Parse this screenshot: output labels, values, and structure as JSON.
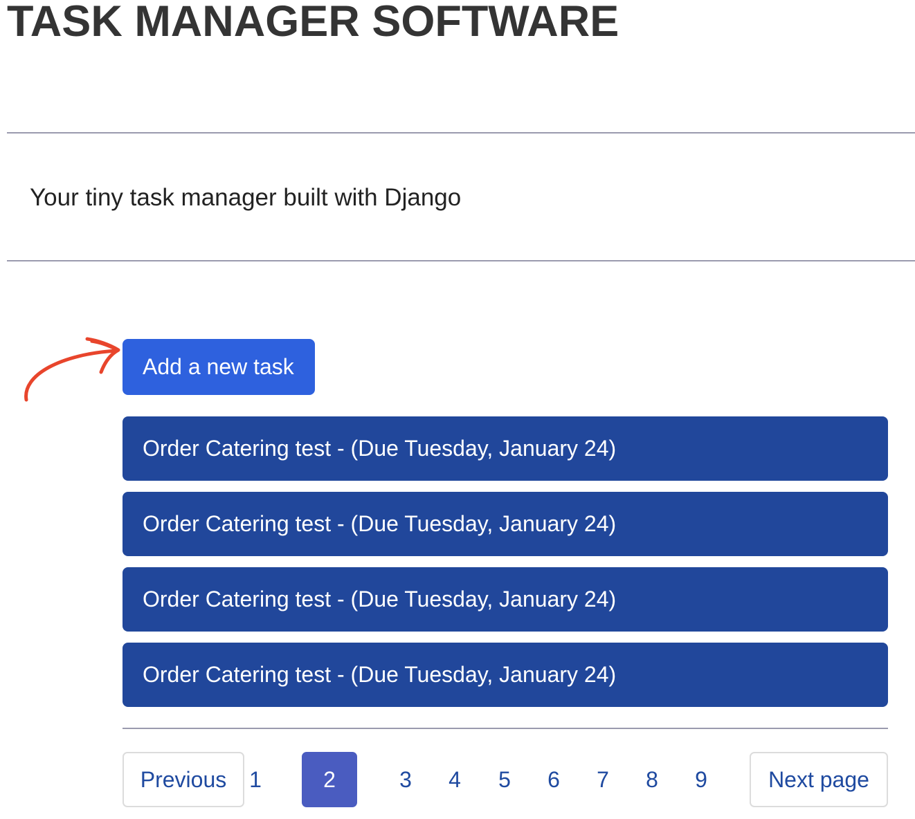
{
  "header": {
    "title": "TASK MANAGER SOFTWARE",
    "tagline": "Your tiny task manager built with Django"
  },
  "actions": {
    "add_task_label": "Add a new task"
  },
  "tasks": [
    {
      "label": "Order Catering test - (Due Tuesday, January 24)"
    },
    {
      "label": "Order Catering test - (Due Tuesday, January 24)"
    },
    {
      "label": "Order Catering test - (Due Tuesday, January 24)"
    },
    {
      "label": "Order Catering test - (Due Tuesday, January 24)"
    }
  ],
  "pagination": {
    "previous_label": "Previous",
    "next_label": "Next page",
    "pages": [
      "1",
      "2",
      "3",
      "4",
      "5",
      "6",
      "7",
      "8",
      "9"
    ],
    "current_page": "2"
  },
  "colors": {
    "add_button": "#2e61de",
    "task_item": "#21479b",
    "current_page": "#4a5cc0",
    "link": "#1f4aa0",
    "annotation_arrow": "#e8452c"
  },
  "icons": {
    "annotation": "hand-drawn-arrow-icon"
  }
}
